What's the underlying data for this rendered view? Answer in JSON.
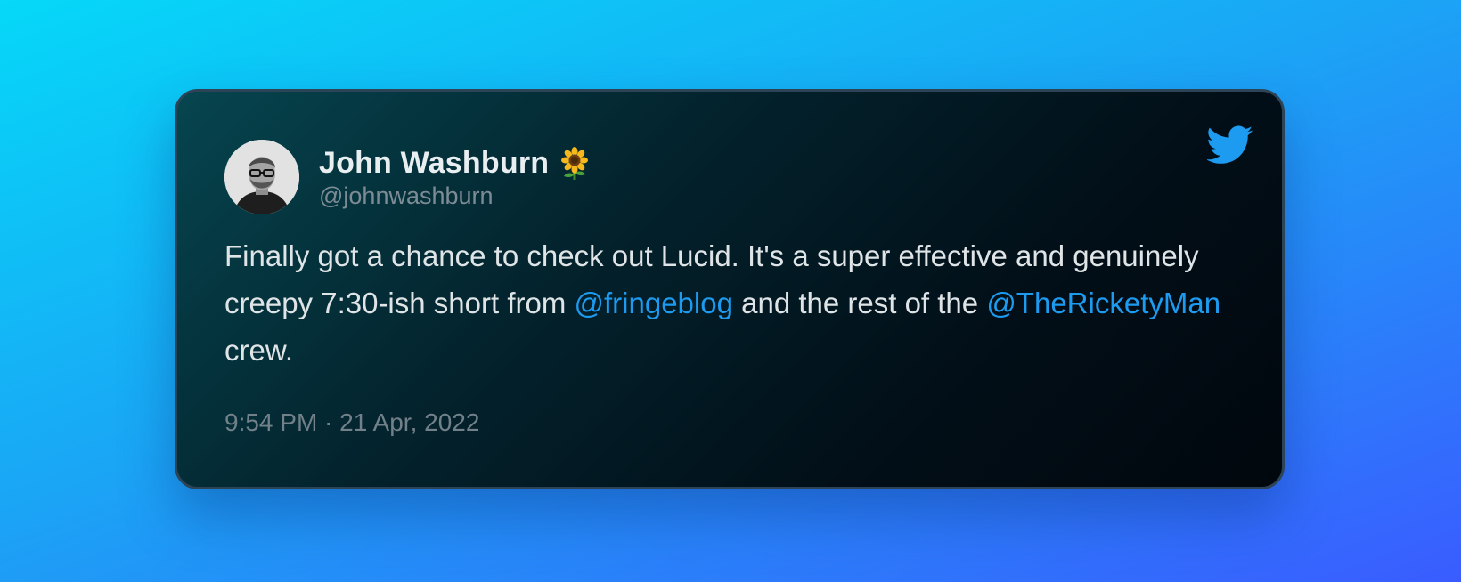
{
  "tweet": {
    "author_name": "John Washburn",
    "author_handle": "@johnwashburn",
    "text_part1": "Finally got a chance to check out Lucid. It's a super effective and genuinely creepy 7:30-ish short from ",
    "mention1": "@fringeblog",
    "text_part2": " and the rest of the ",
    "mention2": "@TheRicketyMan",
    "text_part3": " crew.",
    "timestamp": "9:54 PM · 21 Apr, 2022"
  },
  "icons": {
    "brand": "twitter-bird-icon",
    "name_emoji": "sunflower-icon"
  },
  "colors": {
    "mention": "#1d9bf0",
    "twitter_blue": "#1d9bf0"
  }
}
